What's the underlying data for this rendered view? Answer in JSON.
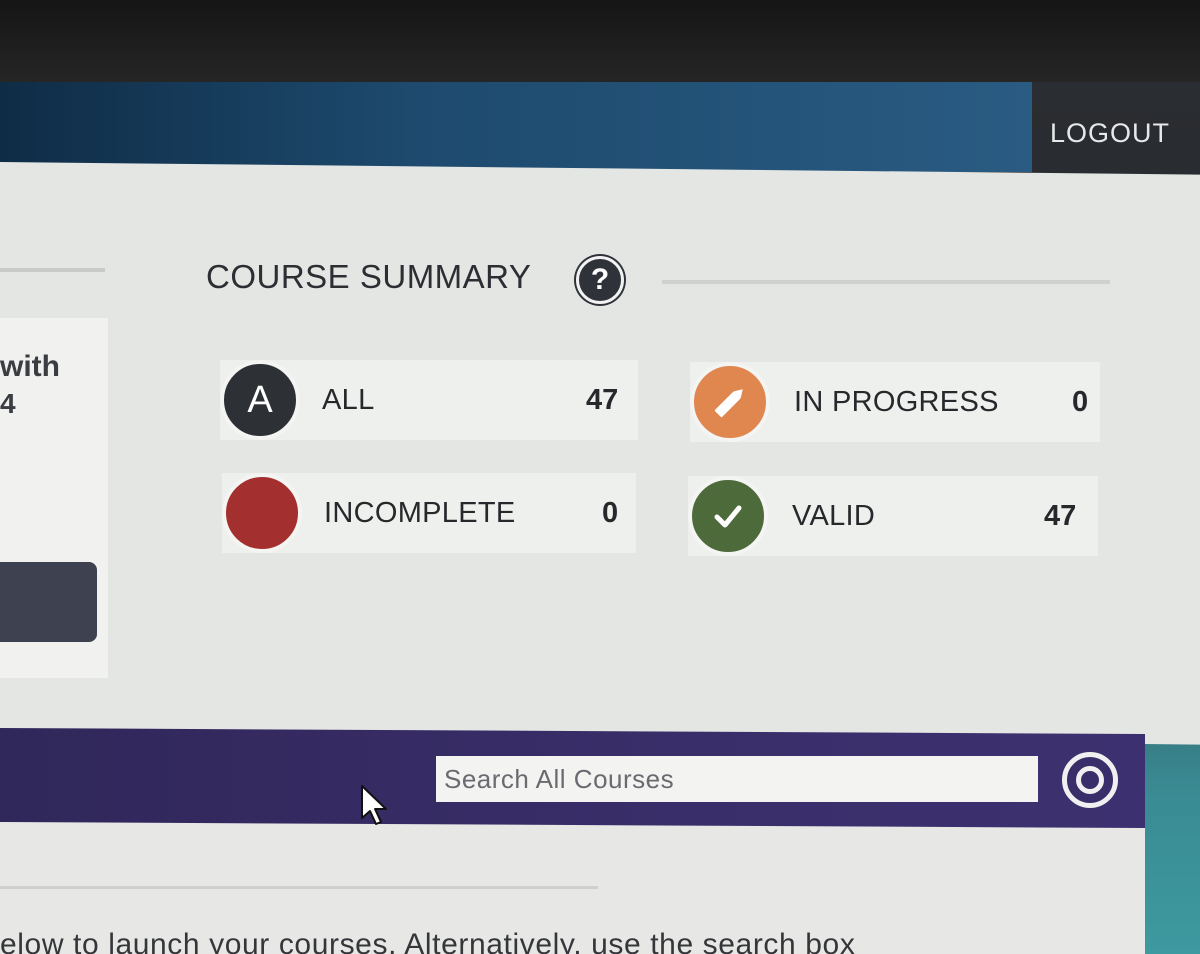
{
  "header": {
    "logout_label": "LOGOUT"
  },
  "left_panel": {
    "text_line_1": "with",
    "text_line_2": "4"
  },
  "course_summary": {
    "title": "COURSE SUMMARY",
    "help_icon": "?",
    "stats": [
      {
        "badge": "A",
        "icon": "letter-a-icon",
        "label": "ALL",
        "count": "47",
        "color": "#2d3035"
      },
      {
        "badge": "",
        "icon": "pencil-icon",
        "label": "IN PROGRESS",
        "count": "0",
        "color": "#e0874f"
      },
      {
        "badge": "",
        "icon": "red-circle-icon",
        "label": "INCOMPLETE",
        "count": "0",
        "color": "#a3302e"
      },
      {
        "badge": "",
        "icon": "check-icon",
        "label": "VALID",
        "count": "47",
        "color": "#4d6a3a"
      }
    ]
  },
  "search": {
    "placeholder": "Search All Courses",
    "button_icon": "search-icon"
  },
  "intro": {
    "text": "elow to launch your courses. Alternatively, use the search box"
  }
}
